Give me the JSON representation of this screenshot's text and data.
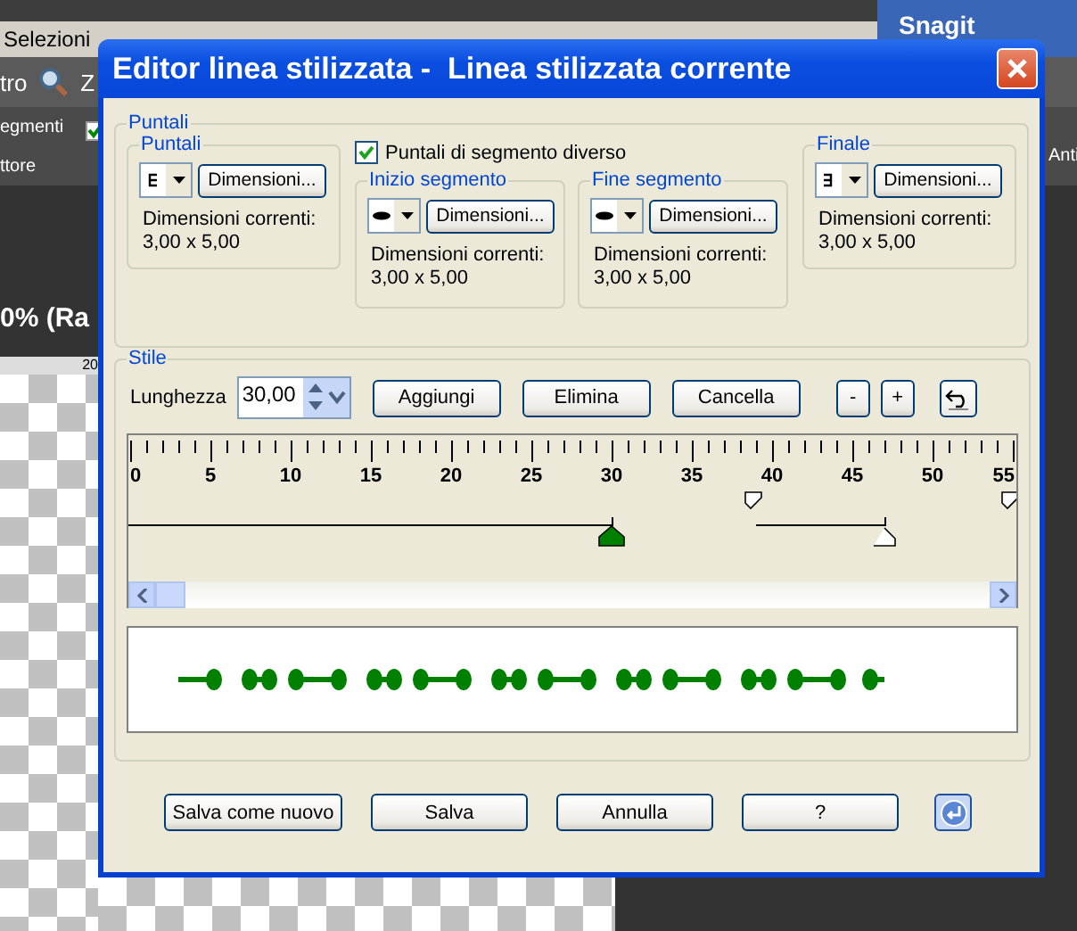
{
  "app": {
    "menu": [
      "Selezioni"
    ],
    "toolbar": [
      "tro",
      "Z"
    ],
    "options": [
      "egmenti",
      "ttore"
    ],
    "option_checkbox": {
      "checked": true
    },
    "right_option": "Anti",
    "brand": "Snagit",
    "document_tab": "0% (Ra",
    "ruler_label": "20"
  },
  "window": {
    "title": "Editor linea stilizzata -  Linea stilizzata corrente"
  },
  "caps": {
    "title": "Puntali",
    "different_segment_caps": {
      "label": "Puntali di segmento diverso",
      "checked": true
    },
    "groups": [
      {
        "title": "Puntali",
        "kind": "start",
        "button": "Dimensioni...",
        "size_label": "Dimensioni correnti:",
        "size": "3,00 x 5,00"
      },
      {
        "title": "Inizio segmento",
        "kind": "segment",
        "button": "Dimensioni...",
        "size_label": "Dimensioni correnti:",
        "size": "3,00 x 5,00"
      },
      {
        "title": "Fine segmento",
        "kind": "segment",
        "button": "Dimensioni...",
        "size_label": "Dimensioni correnti:",
        "size": "3,00 x 5,00"
      },
      {
        "title": "Finale",
        "kind": "end",
        "button": "Dimensioni...",
        "size_label": "Dimensioni correnti:",
        "size": "3,00 x 5,00"
      }
    ]
  },
  "style": {
    "title": "Stile",
    "length": {
      "label": "Lunghezza",
      "value": "30,00"
    },
    "buttons": [
      "Aggiungi",
      "Elimina",
      "Cancella",
      "-",
      "+"
    ],
    "ruler": {
      "labels": [
        "0",
        "5",
        "10",
        "15",
        "20",
        "25",
        "30",
        "35",
        "40",
        "45",
        "50",
        "55"
      ]
    }
  },
  "buttons": [
    "Salva come nuovo",
    "Salva",
    "Annulla",
    "?"
  ]
}
